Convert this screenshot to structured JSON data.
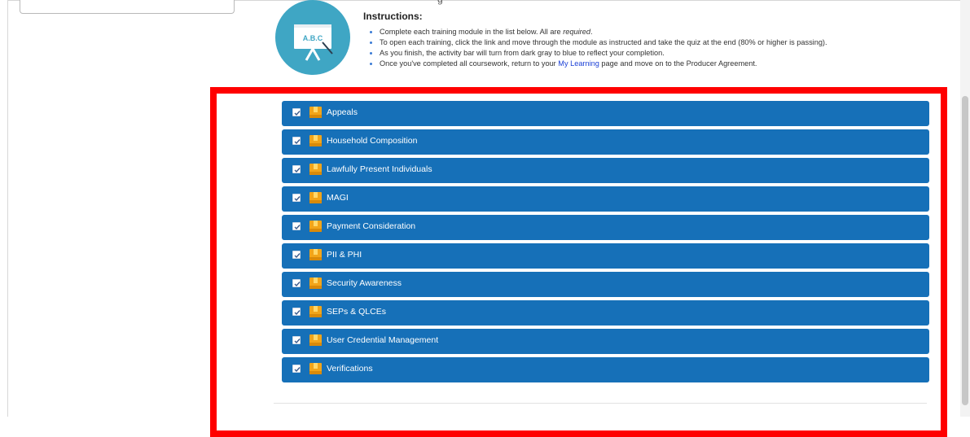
{
  "header": {
    "heading_fragment": "g",
    "icon_text": "A.B.C"
  },
  "instructions": {
    "title": "Instructions:",
    "items": [
      {
        "text_before": "Complete each training module in the list below. All are ",
        "emphasis": "required",
        "text_after": "."
      },
      {
        "text": "To open each training, click the link and move through the module as instructed and take the quiz at the end (80% or higher is passing)."
      },
      {
        "text": "As you finish, the activity bar will turn from dark gray to blue to reflect your completion."
      },
      {
        "text_before": "Once you've completed all coursework, return to your ",
        "link": "My Learning",
        "text_after": " page and move on to the Producer Agreement."
      }
    ]
  },
  "modules": [
    {
      "label": "Appeals",
      "completed": true
    },
    {
      "label": "Household Composition",
      "completed": true
    },
    {
      "label": "Lawfully Present Individuals",
      "completed": true
    },
    {
      "label": "MAGI",
      "completed": true
    },
    {
      "label": "Payment Consideration",
      "completed": true
    },
    {
      "label": "PII & PHI",
      "completed": true
    },
    {
      "label": "Security Awareness",
      "completed": true
    },
    {
      "label": "SEPs & QLCEs",
      "completed": true
    },
    {
      "label": "User Credential Management",
      "completed": true
    },
    {
      "label": "Verifications",
      "completed": true
    }
  ],
  "colors": {
    "module_bar": "#1670b8",
    "highlight": "#ff0000",
    "icon_circle": "#3fa6c4",
    "link": "#1a3fd6"
  }
}
